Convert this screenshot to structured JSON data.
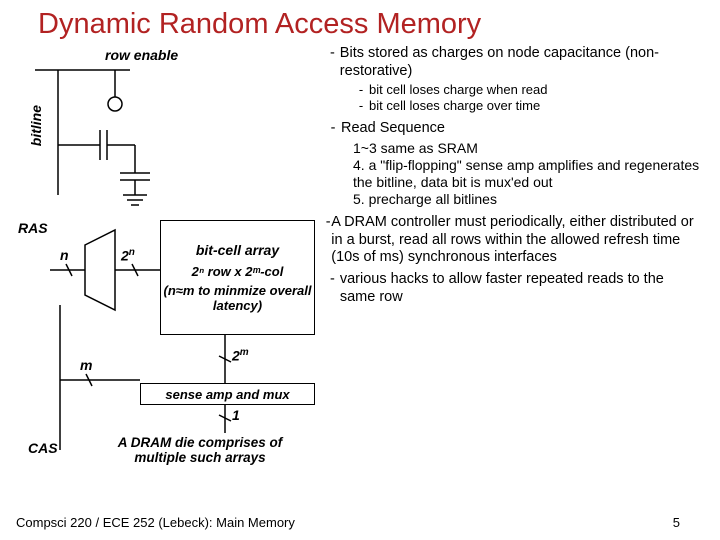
{
  "title": "Dynamic Random Access Memory",
  "diagram": {
    "row_enable": "row enable",
    "bitline": "bitline",
    "ras": "RAS",
    "cas": "CAS",
    "n": "n",
    "m": "m",
    "two_n": "2",
    "two_n_sup": "n",
    "two_m": "2",
    "two_m_sup": "m",
    "bitcell_array": "bit-cell array",
    "row_col": "2ⁿ row x 2ᵐ-col",
    "minimize": "(n≈m to minmize overall latency)",
    "sense_amp": "sense amp and mux",
    "one": "1",
    "die_text": "A DRAM die comprises of multiple such arrays"
  },
  "bullets": {
    "b1": "Bits stored as charges on node capacitance (non-restorative)",
    "b1a": "bit cell loses charge when read",
    "b1b": "bit cell loses charge over time",
    "b2": "Read Sequence",
    "b2_1": "1~3 same as SRAM",
    "b2_4": "4. a \"flip-flopping\" sense amp amplifies and regenerates the bitline, data bit is mux'ed out",
    "b2_5": "5. precharge all bitlines",
    "b3": "A DRAM controller must periodically, either distributed or in a burst, read all rows within the allowed refresh time (10s of ms) synchronous interfaces",
    "b4": "various hacks to allow faster repeated reads to the same row"
  },
  "footer": {
    "left": "Compsci 220 / ECE 252 (Lebeck): Main Memory",
    "right": "5"
  }
}
